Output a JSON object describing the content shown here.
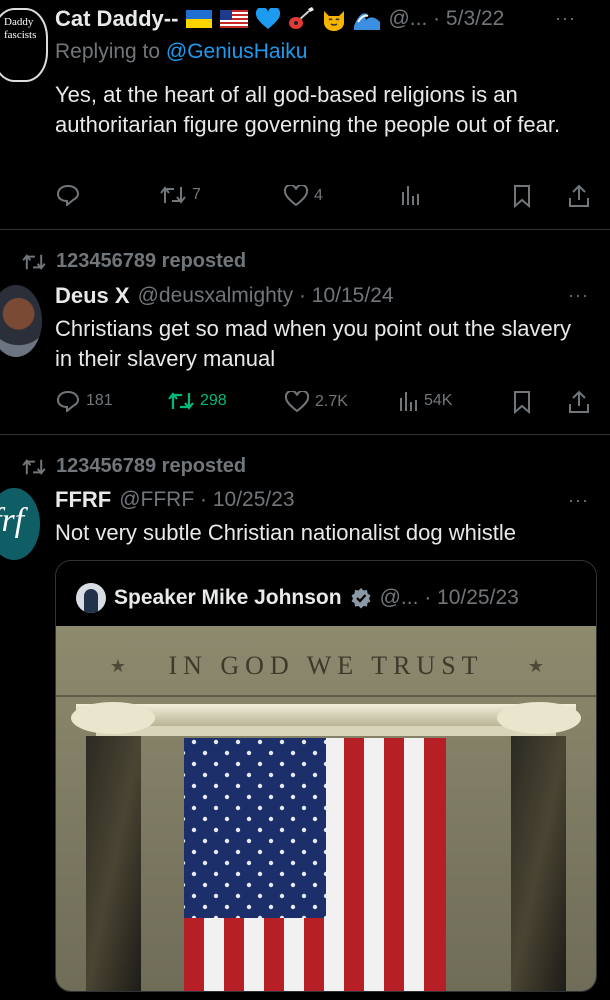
{
  "tweet1": {
    "avatar_text": [
      "Daddy",
      "fascists"
    ],
    "name": "Cat Daddy--",
    "emojis": [
      "ukraine-flag",
      "us-flag",
      "blue-heart",
      "guitar",
      "cat-face",
      "wave"
    ],
    "handle_date": "@... · 5/3/22",
    "replying_prefix": "Replying to",
    "replying_handle": "@GeniusHaiku",
    "text": "Yes, at the heart of all god-based religions is an authoritarian figure governing the people out of fear.",
    "reposts": "7",
    "likes": "4"
  },
  "tweet2": {
    "repost_label": "123456789 reposted",
    "name": "Deus X",
    "handle_date": "@deusxalmighty · 10/15/24",
    "text": "Christians get so mad when you point out the slavery in their slavery manual",
    "replies": "181",
    "reposts": "298",
    "likes": "2.7K",
    "views": "54K"
  },
  "tweet3": {
    "repost_label": "123456789 reposted",
    "avatar_text": "frf",
    "name": "FFRF",
    "handle_date": "@FFRF · 10/25/23",
    "text": "Not very subtle Christian nationalist dog whistle",
    "quote": {
      "name": "Speaker Mike Johnson",
      "handle_date": "@... · 10/25/23",
      "image_text": "IN GOD WE TRUST"
    }
  },
  "more_glyph": "···",
  "colors": {
    "background": "#000000",
    "muted": "#71767b",
    "link": "#1d9bf0",
    "repost_active": "#00ba7c"
  }
}
